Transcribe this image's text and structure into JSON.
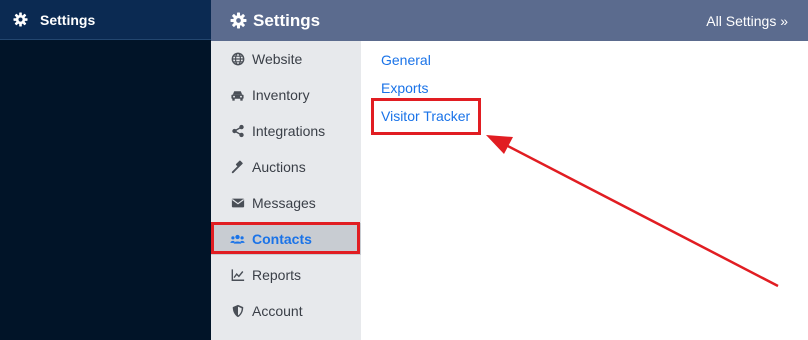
{
  "sidebar": {
    "title": "Settings",
    "icon": "gear-icon"
  },
  "header": {
    "title": "Settings",
    "icon": "gear-icon",
    "all_settings_link": "All Settings »"
  },
  "nav": {
    "items": [
      {
        "label": "Website",
        "icon": "globe-icon",
        "active": false
      },
      {
        "label": "Inventory",
        "icon": "car-icon",
        "active": false
      },
      {
        "label": "Integrations",
        "icon": "share-icon",
        "active": false
      },
      {
        "label": "Auctions",
        "icon": "gavel-icon",
        "active": false
      },
      {
        "label": "Messages",
        "icon": "envelope-icon",
        "active": false
      },
      {
        "label": "Contacts",
        "icon": "users-icon",
        "active": true
      },
      {
        "label": "Reports",
        "icon": "chart-line-icon",
        "active": false
      },
      {
        "label": "Account",
        "icon": "shield-icon",
        "active": false
      }
    ]
  },
  "content": {
    "links": [
      {
        "label": "General"
      },
      {
        "label": "Exports"
      },
      {
        "label": "Visitor Tracker"
      }
    ]
  },
  "colors": {
    "sidebar_bg": "#011428",
    "header_bg": "#5b6b8e",
    "nav_bg": "#e7e9ec",
    "link": "#1a73e8",
    "annotation": "#e11d22"
  }
}
